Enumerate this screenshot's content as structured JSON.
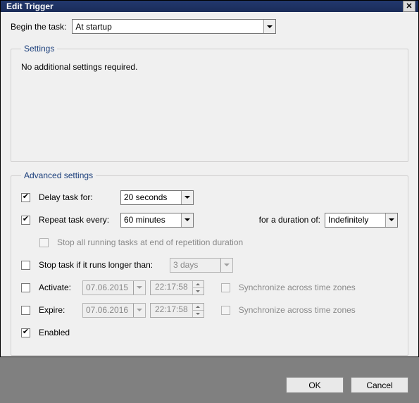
{
  "titlebar": {
    "title": "Edit Trigger"
  },
  "beginTask": {
    "label": "Begin the task:",
    "value": "At startup"
  },
  "settingsGroup": {
    "legend": "Settings",
    "message": "No additional settings required."
  },
  "advancedGroup": {
    "legend": "Advanced settings",
    "delay": {
      "checked": true,
      "label": "Delay task for:",
      "value": "20 seconds"
    },
    "repeat": {
      "checked": true,
      "label": "Repeat task every:",
      "value": "60 minutes",
      "durationLabel": "for a duration of:",
      "durationValue": "Indefinitely"
    },
    "stopAll": {
      "checked": false,
      "enabled": false,
      "label": "Stop all running tasks at end of repetition duration"
    },
    "stopIfLonger": {
      "checked": false,
      "label": "Stop task if it runs longer than:",
      "value": "3 days"
    },
    "activate": {
      "checked": false,
      "label": "Activate:",
      "date": "07.06.2015",
      "time": "22:17:58",
      "syncLabel": "Synchronize across time zones",
      "syncChecked": false
    },
    "expire": {
      "checked": false,
      "label": "Expire:",
      "date": "07.06.2016",
      "time": "22:17:58",
      "syncLabel": "Synchronize across time zones",
      "syncChecked": false
    },
    "enabled": {
      "checked": true,
      "label": "Enabled"
    }
  },
  "buttons": {
    "ok": "OK",
    "cancel": "Cancel"
  }
}
